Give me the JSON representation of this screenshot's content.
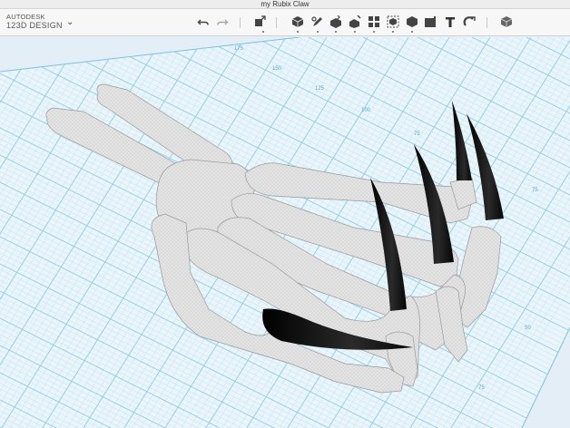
{
  "window": {
    "title": "my Rubix Claw"
  },
  "app": {
    "brand_line1": "AUTODESK",
    "brand_line2": "123D DESIGN"
  },
  "toolbar": {
    "items": [
      {
        "name": "undo-button",
        "icon": "undo-icon"
      },
      {
        "name": "redo-button",
        "icon": "redo-icon"
      },
      {
        "name": "transform-button",
        "icon": "transform-icon"
      },
      {
        "name": "primitives-button",
        "icon": "cube-icon"
      },
      {
        "name": "sketch-button",
        "icon": "sketch-icon"
      },
      {
        "name": "construct-button",
        "icon": "construct-icon"
      },
      {
        "name": "modify-button",
        "icon": "modify-icon"
      },
      {
        "name": "pattern-button",
        "icon": "pattern-icon"
      },
      {
        "name": "grouping-button",
        "icon": "group-icon"
      },
      {
        "name": "combine-button",
        "icon": "combine-icon"
      },
      {
        "name": "measure-button",
        "icon": "measure-icon"
      },
      {
        "name": "text-button",
        "icon": "text-icon"
      },
      {
        "name": "snap-button",
        "icon": "snap-icon"
      },
      {
        "name": "material-button",
        "icon": "material-icon"
      }
    ]
  },
  "viewport": {
    "grid_labels": [
      "175",
      "150",
      "125",
      "100",
      "75",
      "75",
      "50",
      "75"
    ],
    "colors": {
      "background": "#e4eef6",
      "grid_major": "#8fcde9",
      "grid_minor": "#c2e3f3",
      "bone": "#e6e6e6",
      "claw": "#141414"
    }
  }
}
